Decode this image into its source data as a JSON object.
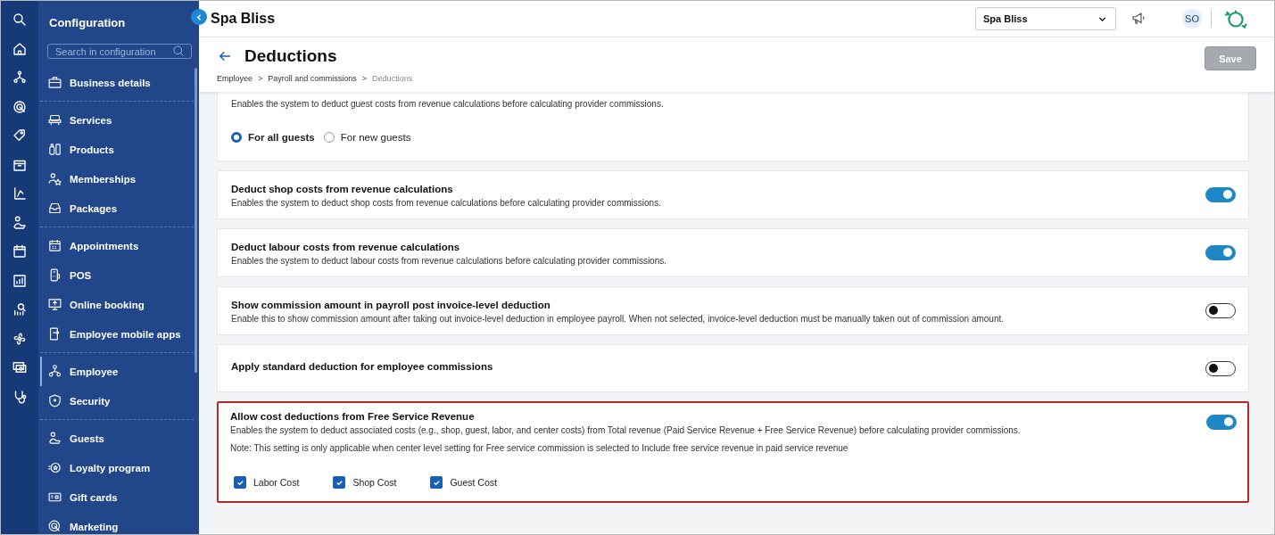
{
  "sidebar": {
    "title": "Configuration",
    "search": {
      "placeholder": "Search in configuration"
    },
    "groups": [
      [
        {
          "label": "Business details",
          "selected": false
        }
      ],
      [
        {
          "label": "Services",
          "selected": false
        },
        {
          "label": "Products",
          "selected": false
        },
        {
          "label": "Memberships",
          "selected": false
        },
        {
          "label": "Packages",
          "selected": false
        }
      ],
      [
        {
          "label": "Appointments",
          "selected": false
        },
        {
          "label": "POS",
          "selected": false
        },
        {
          "label": "Online booking",
          "selected": false
        },
        {
          "label": "Employee mobile apps",
          "selected": false
        }
      ],
      [
        {
          "label": "Employee",
          "selected": true
        },
        {
          "label": "Security",
          "selected": false
        }
      ],
      [
        {
          "label": "Guests",
          "selected": false
        },
        {
          "label": "Loyalty program",
          "selected": false
        },
        {
          "label": "Gift cards",
          "selected": false
        },
        {
          "label": "Marketing",
          "selected": false
        }
      ]
    ]
  },
  "topbar": {
    "business": "Spa Bliss",
    "location_select": "Spa Bliss",
    "avatar": "SO"
  },
  "page": {
    "title": "Deductions",
    "breadcrumb": [
      "Employee",
      "Payroll and commissions",
      "Deductions"
    ],
    "breadcrumb_separator": ">",
    "save": {
      "label": "Save",
      "disabled": true
    }
  },
  "settings": [
    {
      "kind": "radios",
      "description": "Enables the system to deduct guest costs from revenue calculations before calculating provider commissions.",
      "options": [
        {
          "label": "For all guests",
          "selected": true
        },
        {
          "label": "For new guests",
          "selected": false
        }
      ]
    },
    {
      "kind": "toggle",
      "title": "Deduct shop costs from revenue calculations",
      "description": "Enables the system to deduct shop costs from revenue calculations before calculating provider commissions.",
      "on": true,
      "highlighted": false
    },
    {
      "kind": "toggle",
      "title": "Deduct labour costs from revenue calculations",
      "description": "Enables the system to deduct labour costs from revenue calculations before calculating provider commissions.",
      "on": true,
      "highlighted": false
    },
    {
      "kind": "toggle",
      "title": "Show commission amount in payroll post invoice-level deduction",
      "description": "Enable this to show commission amount after taking out invoice-level deduction in employee payroll. When not selected, invoice-level deduction must be manually taken out of commission amount.",
      "on": false,
      "highlighted": false
    },
    {
      "kind": "toggle",
      "title": "Apply standard deduction for employee commissions",
      "on": false,
      "highlighted": false
    },
    {
      "kind": "toggle",
      "title": "Allow cost deductions from Free Service Revenue",
      "description": "Enables the system to deduct associated costs (e.g., shop, guest, labor, and center costs) from Total revenue (Paid Service Revenue + Free Service Revenue) before calculating provider commissions.",
      "note": "Note: This setting is only applicable when center level setting for Free service commission is selected to Include free service revenue in paid service revenue",
      "on": true,
      "highlighted": true,
      "checkboxes": [
        {
          "label": "Labor Cost",
          "checked": true
        },
        {
          "label": "Shop Cost",
          "checked": true
        },
        {
          "label": "Guest Cost",
          "checked": true
        }
      ]
    }
  ]
}
